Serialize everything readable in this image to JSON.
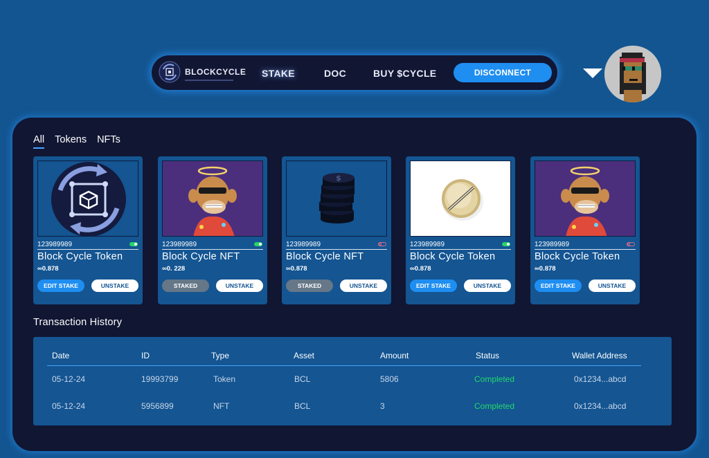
{
  "nav": {
    "brand": "BLOCKCYCLE",
    "links": [
      "STAKE",
      "DOC",
      "BUY $CYCLE"
    ],
    "disconnect_label": "DISCONNECT"
  },
  "filters": [
    "All",
    "Tokens",
    "NFTs"
  ],
  "cards": [
    {
      "id": "123989989",
      "title": "Block Cycle Token",
      "amount": "∞0.878",
      "left_button": "EDIT STAKE",
      "right_button": "UNSTAKE",
      "toggle": "on",
      "image": "blockcycle-logo"
    },
    {
      "id": "123989989",
      "title": "Block Cycle NFT",
      "amount": "∞0. 228",
      "left_button": "STAKED",
      "right_button": "UNSTAKE",
      "toggle": "on",
      "image": "ape-nft"
    },
    {
      "id": "123989989",
      "title": "Block Cycle NFT",
      "amount": "∞0.878",
      "left_button": "STAKED",
      "right_button": "UNSTAKE",
      "toggle": "off",
      "image": "coin-stack"
    },
    {
      "id": "123989989",
      "title": "Block Cycle Token",
      "amount": "∞0.878",
      "left_button": "EDIT STAKE",
      "right_button": "UNSTAKE",
      "toggle": "on",
      "image": "gold-token"
    },
    {
      "id": "123989989",
      "title": "Block Cycle Token",
      "amount": "∞0.878",
      "left_button": "EDIT STAKE",
      "right_button": "UNSTAKE",
      "toggle": "off",
      "image": "ape-nft"
    }
  ],
  "transactions": {
    "title": "Transaction History",
    "columns": [
      "Date",
      "ID",
      "Type",
      "Asset",
      "Amount",
      "Status",
      "Wallet Address"
    ],
    "rows": [
      [
        "05-12-24",
        "19993799",
        "Token",
        "BCL",
        "5806",
        "Completed",
        "0x1234...abcd"
      ],
      [
        "05-12-24",
        "5956899",
        "NFT",
        "BCL",
        "3",
        "Completed",
        "0x1234...abcd"
      ]
    ]
  },
  "colors": {
    "background": "#135591",
    "panel": "#111633",
    "accent": "#1f8ef1",
    "status_completed": "#23d96b",
    "staked_button": "#667788"
  }
}
